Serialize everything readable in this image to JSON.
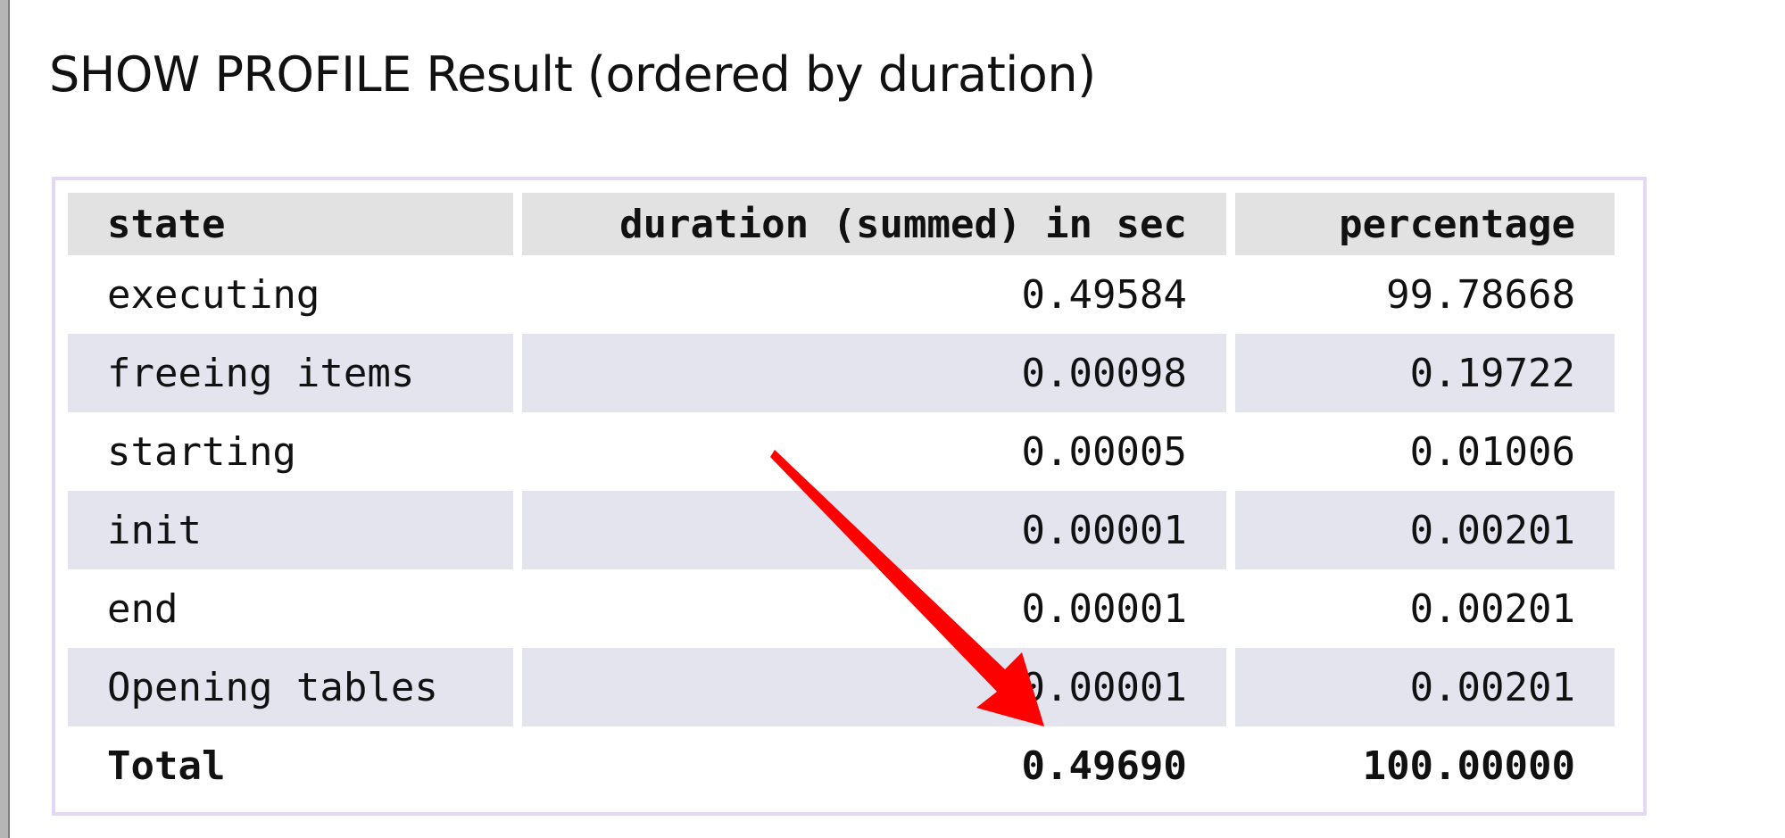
{
  "title": "SHOW PROFILE Result (ordered by duration)",
  "table": {
    "headers": {
      "state": "state",
      "duration": "duration (summed) in sec",
      "percentage": "percentage"
    },
    "rows": [
      {
        "state": "executing",
        "duration": "0.49584",
        "percentage": "99.78668"
      },
      {
        "state": "freeing items",
        "duration": "0.00098",
        "percentage": "0.19722"
      },
      {
        "state": "starting",
        "duration": "0.00005",
        "percentage": "0.01006"
      },
      {
        "state": "init",
        "duration": "0.00001",
        "percentage": "0.00201"
      },
      {
        "state": "end",
        "duration": "0.00001",
        "percentage": "0.00201"
      },
      {
        "state": "Opening tables",
        "duration": "0.00001",
        "percentage": "0.00201"
      }
    ],
    "total": {
      "state": "Total",
      "duration": "0.49690",
      "percentage": "100.00000"
    }
  },
  "annotation": {
    "icon": "red-arrow-icon",
    "color": "#ff0000"
  },
  "colors": {
    "header_bg": "#e2e2e2",
    "alt_row_bg": "#e3e4ee",
    "frame_border": "#e3d8f5"
  }
}
